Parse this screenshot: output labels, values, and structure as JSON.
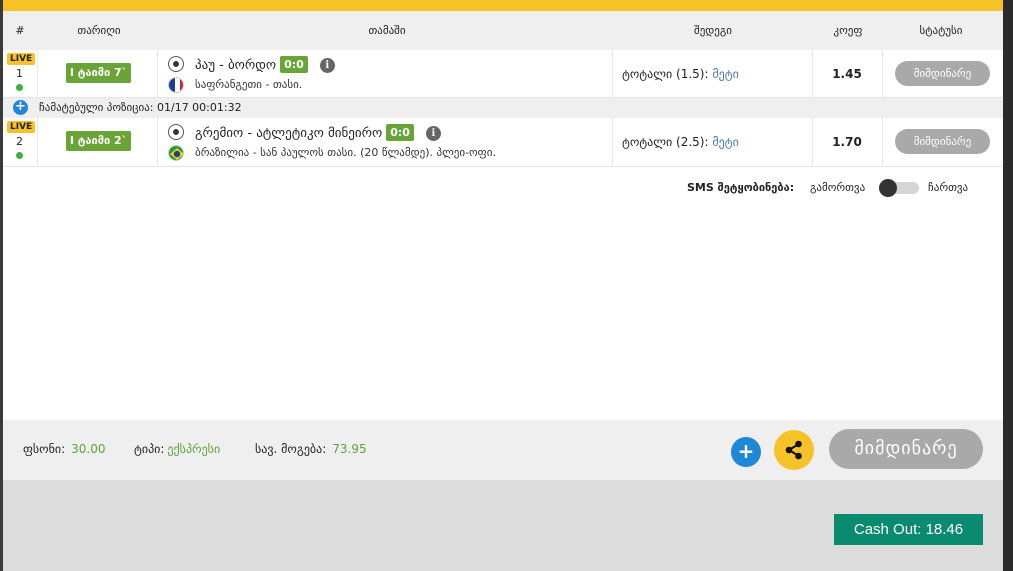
{
  "header": {
    "col_num": "#",
    "col_date": "თარიღი",
    "col_match": "თამაში",
    "col_result": "შედეგი",
    "col_odds": "კოეფ",
    "col_status": "სტატუსი"
  },
  "bets": [
    {
      "live": "LIVE",
      "num": "1",
      "time": "I ტაიმი 7`",
      "match": "პაუ - ბორდო",
      "score": "0:0",
      "league": "საფრანგეთი - თასი.",
      "bet_label": "ტოტალი (1.5):",
      "bet_pick": "მეტი",
      "odds": "1.45",
      "status": "მიმდინარე"
    },
    {
      "live": "LIVE",
      "num": "2",
      "time": "I ტაიმი 2`",
      "match": "გრემიო - ატლეტიკო მინეირო",
      "score": "0:0",
      "league": "ბრაზილია - სან პაულოს თასი. (20 წლამდე). პლეი-ოფი.",
      "bet_label": "ტოტალი (2.5):",
      "bet_pick": "მეტი",
      "odds": "1.70",
      "status": "მიმდინარე"
    }
  ],
  "position": "ჩამატებული პოზიცია: 01/17 00:01:32",
  "sms": {
    "label": "SMS შეტყობინება:",
    "off": "გამორთვა",
    "on": "ჩართვა"
  },
  "footer": {
    "stake_label": "ფსონი:",
    "stake_value": "30.00",
    "type_label": "ტიპი:",
    "type_value": "ექსპრესი",
    "win_label": "სავ. მოგება:",
    "win_value": "73.95",
    "status": "მიმდინარე"
  },
  "cashout": "Cash Out: 18.46",
  "colors": {
    "accent": "#f5c327",
    "live_green": "#6aa437",
    "cashout": "#0a8a6e",
    "link_blue": "#1e88d6"
  }
}
